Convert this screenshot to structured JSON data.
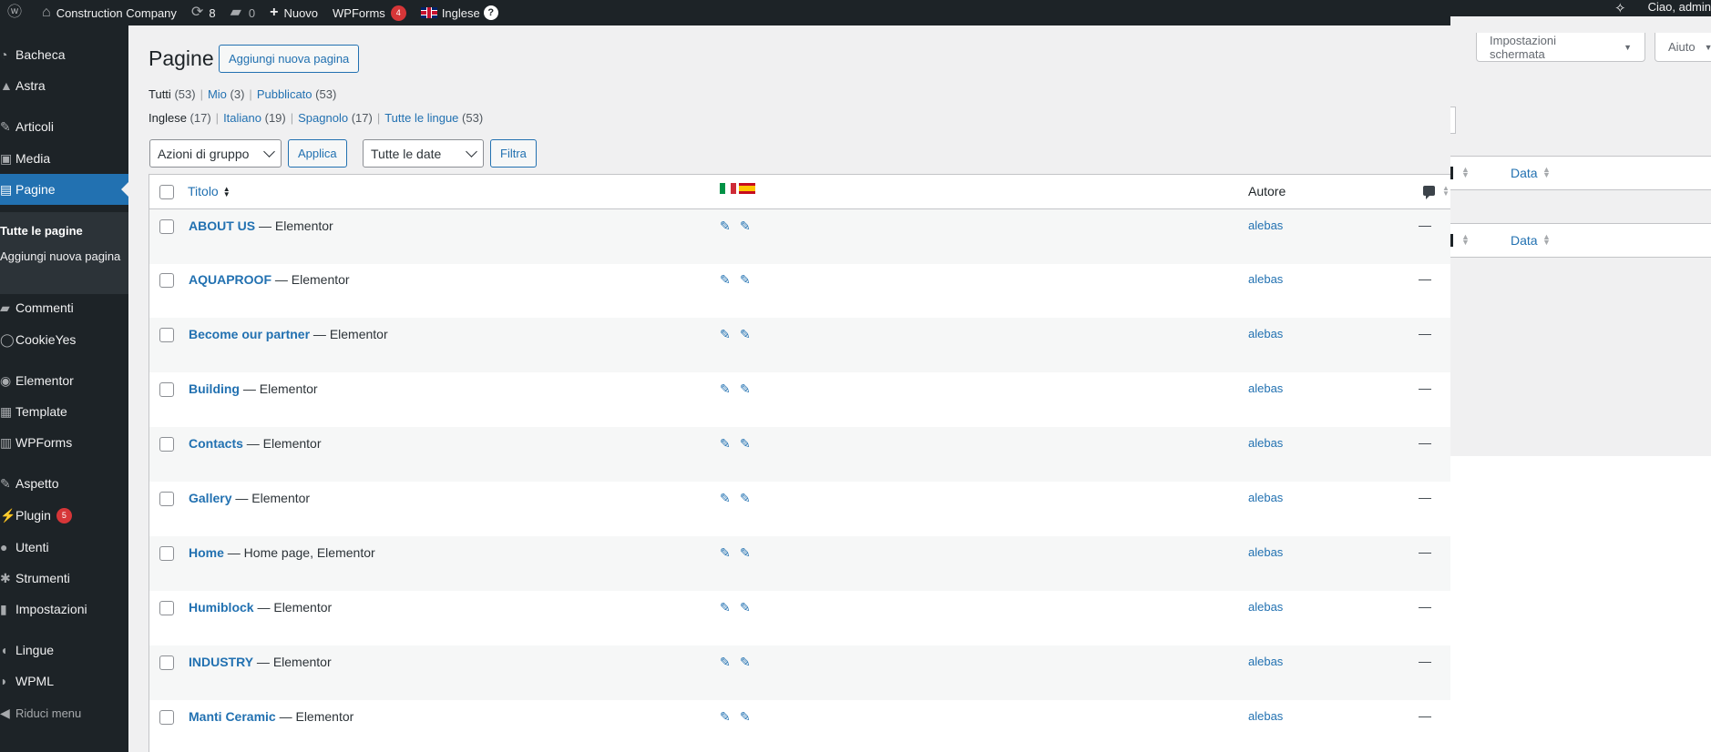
{
  "adminbar": {
    "site_name": "Construction Company",
    "updates_count": "8",
    "comments_count": "0",
    "new_label": "Nuovo",
    "wpforms_label": "WPForms",
    "wpforms_badge": "4",
    "language_label": "Inglese",
    "help_badge": "?",
    "greeting": "Ciao, admin"
  },
  "screen_meta": {
    "screen_options": "Impostazioni schermata",
    "help": "Aiuto"
  },
  "sidebar": {
    "items": [
      {
        "label": "Bacheca",
        "icon": "dashboard-icon"
      },
      {
        "label": "Astra",
        "icon": "astra-icon"
      },
      {
        "label": "Articoli",
        "icon": "pin-icon"
      },
      {
        "label": "Media",
        "icon": "media-icon"
      },
      {
        "label": "Pagine",
        "icon": "pages-icon"
      },
      {
        "label": "Commenti",
        "icon": "comments-icon"
      },
      {
        "label": "CookieYes",
        "icon": "cookieyes-icon"
      },
      {
        "label": "Elementor",
        "icon": "elementor-icon"
      },
      {
        "label": "Template",
        "icon": "template-icon"
      },
      {
        "label": "WPForms",
        "icon": "wpforms-icon"
      },
      {
        "label": "Aspetto",
        "icon": "appearance-icon"
      },
      {
        "label": "Plugin",
        "icon": "plugins-icon",
        "badge": "5"
      },
      {
        "label": "Utenti",
        "icon": "users-icon"
      },
      {
        "label": "Strumenti",
        "icon": "tools-icon"
      },
      {
        "label": "Impostazioni",
        "icon": "settings-icon"
      },
      {
        "label": "Lingue",
        "icon": "languages-icon"
      },
      {
        "label": "WPML",
        "icon": "wpml-icon"
      }
    ],
    "submenu": [
      "Tutte le pagine",
      "Aggiungi nuova pagina"
    ],
    "collapse": "Riduci menu"
  },
  "main": {
    "title": "Pagine",
    "add_new": "Aggiungi nuova pagina",
    "status_filters": [
      {
        "label": "Tutti",
        "count": "(53)"
      },
      {
        "label": "Mio",
        "count": "(3)"
      },
      {
        "label": "Pubblicato",
        "count": "(53)"
      }
    ],
    "lang_filters": [
      {
        "label": "Inglese",
        "count": "(17)"
      },
      {
        "label": "Italiano",
        "count": "(19)"
      },
      {
        "label": "Spagnolo",
        "count": "(17)"
      },
      {
        "label": "Tutte le lingue",
        "count": "(53)"
      }
    ],
    "bulk_actions": "Azioni di gruppo",
    "apply": "Applica",
    "dates": "Tutte le date",
    "filter": "Filtra"
  },
  "table": {
    "columns": {
      "title": "Titolo",
      "author": "Autore",
      "date": "Data"
    },
    "rows": [
      {
        "title": "ABOUT US",
        "suffix": " — Elementor",
        "author": "alebas",
        "comments": "—"
      },
      {
        "title": "AQUAPROOF",
        "suffix": " — Elementor",
        "author": "alebas",
        "comments": "—"
      },
      {
        "title": "Become our partner",
        "suffix": " — Elementor",
        "author": "alebas",
        "comments": "—"
      },
      {
        "title": "Building",
        "suffix": " — Elementor",
        "author": "alebas",
        "comments": "—"
      },
      {
        "title": "Contacts",
        "suffix": " — Elementor",
        "author": "alebas",
        "comments": "—"
      },
      {
        "title": "Gallery",
        "suffix": " — Elementor",
        "author": "alebas",
        "comments": "—"
      },
      {
        "title": "Home",
        "suffix": " — Home page, Elementor",
        "author": "alebas",
        "comments": "—"
      },
      {
        "title": "Humiblock",
        "suffix": " — Elementor",
        "author": "alebas",
        "comments": "—"
      },
      {
        "title": "INDUSTRY",
        "suffix": " — Elementor",
        "author": "alebas",
        "comments": "—"
      },
      {
        "title": "Manti Ceramic",
        "suffix": " — Elementor",
        "author": "alebas",
        "comments": "—"
      }
    ]
  },
  "colors": {
    "accent": "#2271b1",
    "adminbar": "#1d2327",
    "badge": "#d63638"
  }
}
